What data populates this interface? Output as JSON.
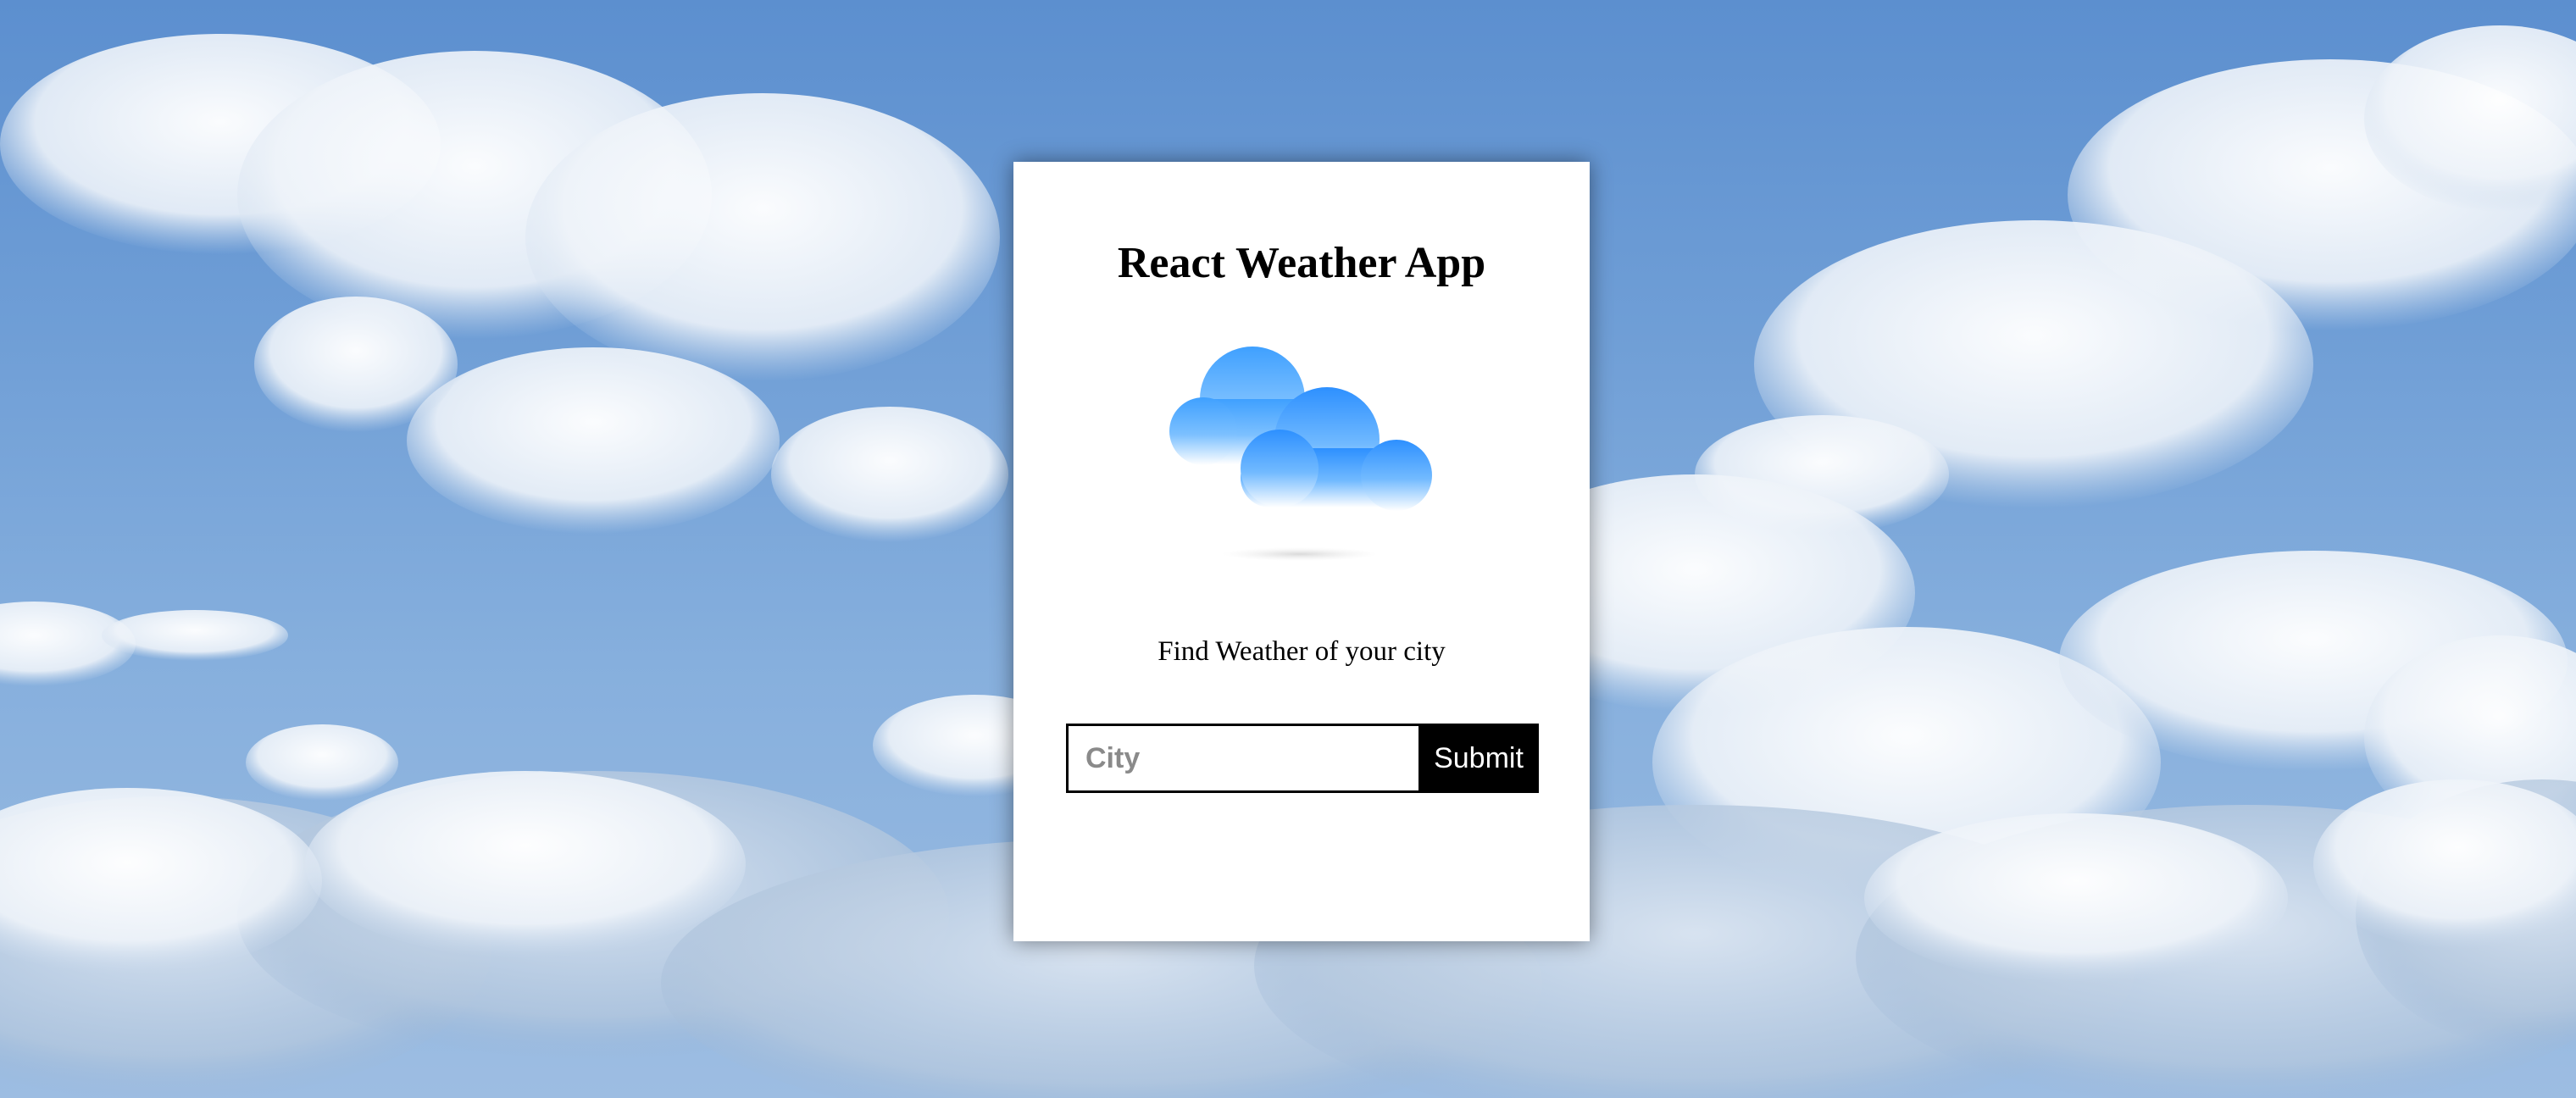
{
  "app": {
    "title": "React Weather App",
    "subtitle": "Find Weather of your city"
  },
  "form": {
    "city_placeholder": "City",
    "city_value": "",
    "submit_label": "Submit"
  },
  "icons": {
    "weather": "cloud-icon"
  },
  "colors": {
    "sky": "#6f9ed6",
    "card": "#ffffff",
    "cloud_top": "#3fa0ff",
    "cloud_bottom": "#ffffff",
    "button_bg": "#000000",
    "button_text": "#ffffff"
  }
}
